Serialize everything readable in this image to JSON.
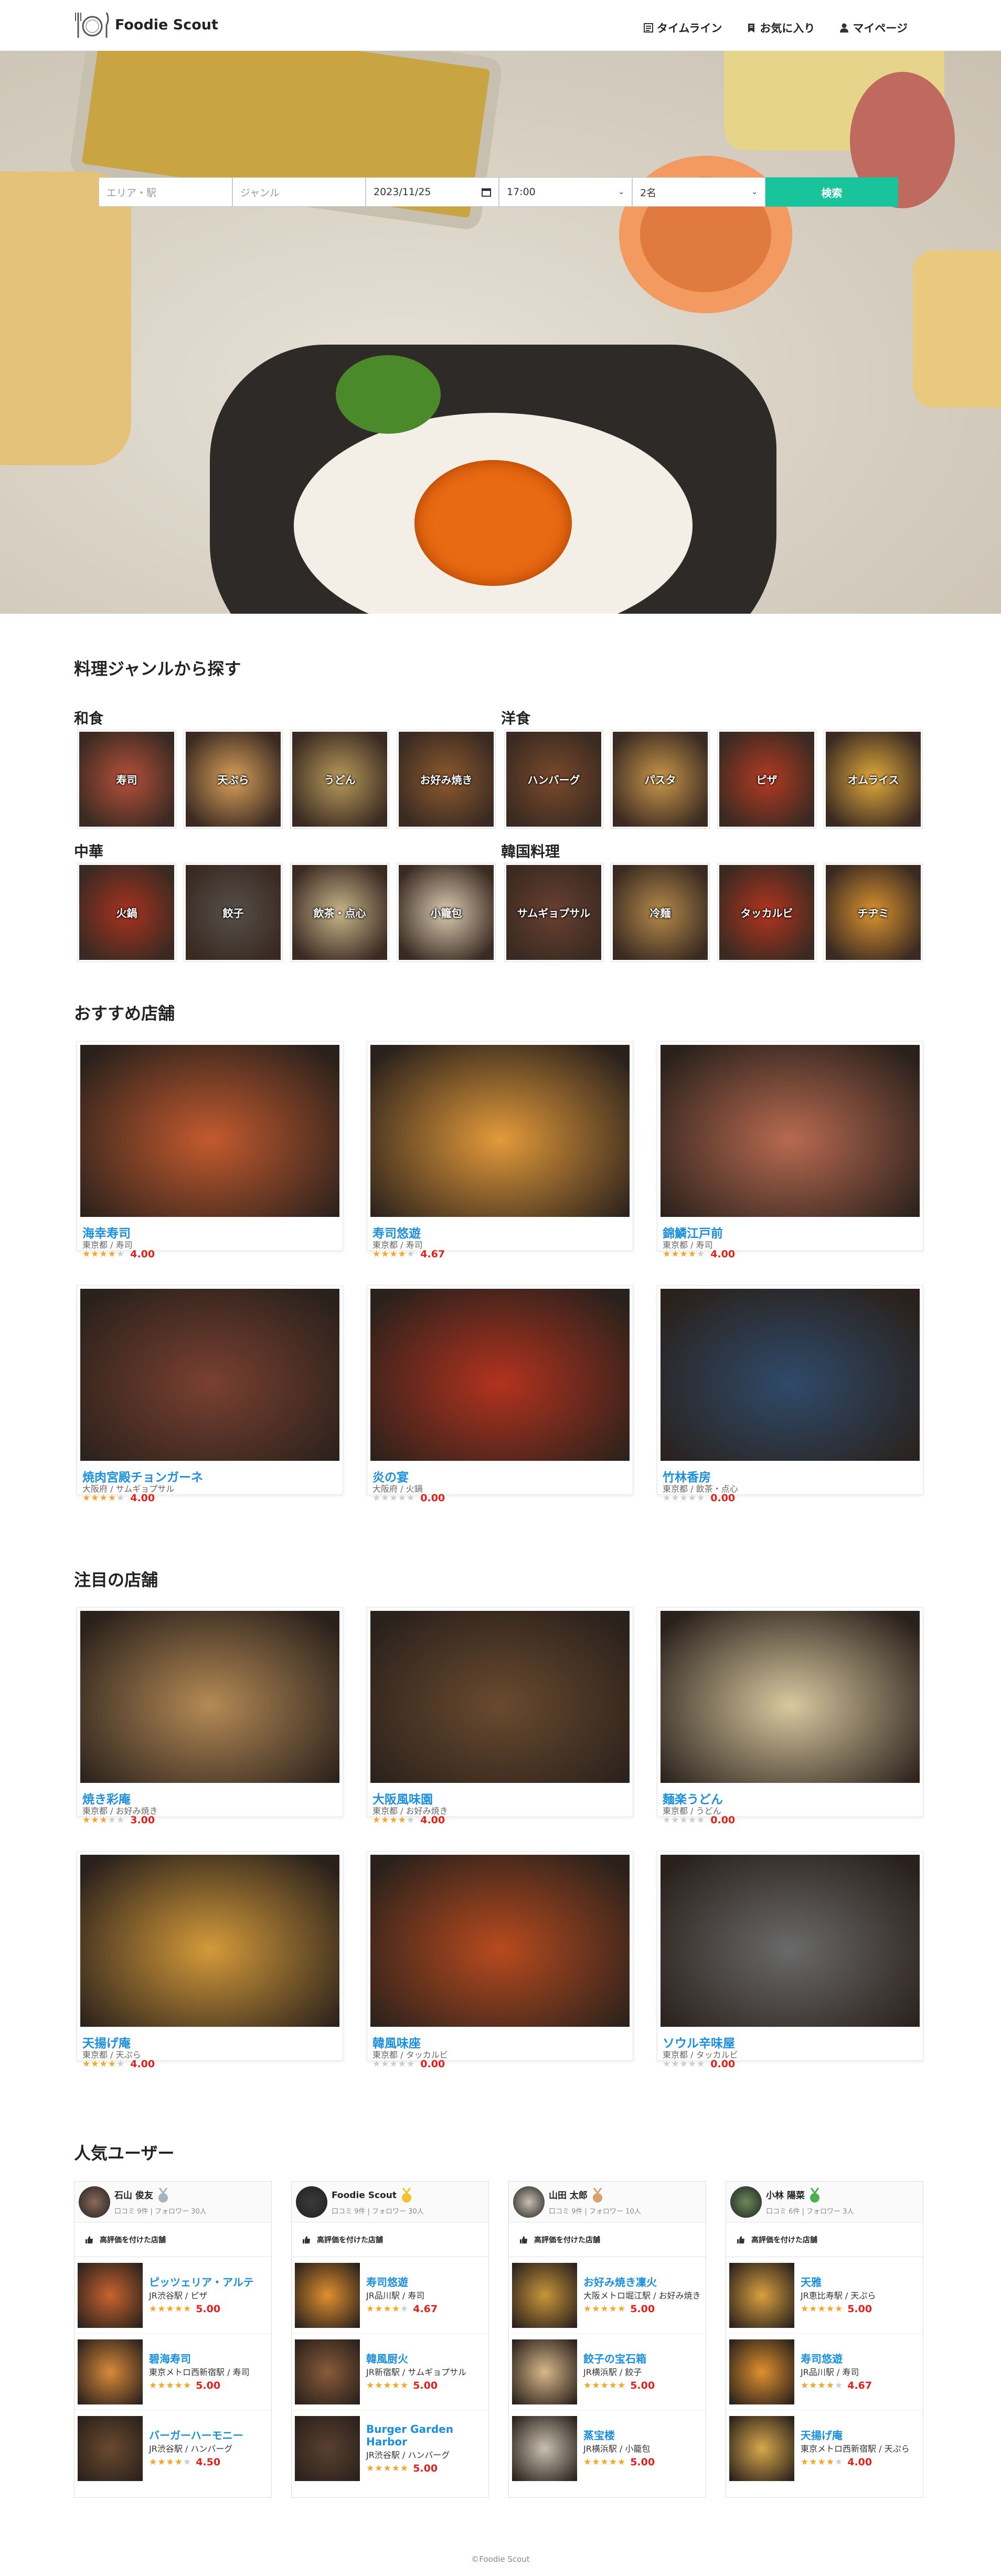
{
  "header": {
    "brand": "Foodie Scout",
    "nav": [
      {
        "label": "タイムライン",
        "icon": "timeline-icon"
      },
      {
        "label": "お気に入り",
        "icon": "bookmark-icon"
      },
      {
        "label": "マイページ",
        "icon": "user-icon"
      }
    ]
  },
  "search": {
    "area_placeholder": "エリア・駅",
    "genre_placeholder": "ジャンル",
    "date": "2023/11/25",
    "time": "17:00",
    "people": "2名",
    "button": "検索"
  },
  "genres": {
    "title": "料理ジャンルから探す",
    "categories": [
      {
        "name": "和食",
        "items": [
          "寿司",
          "天ぷら",
          "うどん",
          "お好み焼き"
        ]
      },
      {
        "name": "洋食",
        "items": [
          "ハンバーグ",
          "パスタ",
          "ピザ",
          "オムライス"
        ]
      },
      {
        "name": "中華",
        "items": [
          "火鍋",
          "餃子",
          "飲茶・点心",
          "小籠包"
        ]
      },
      {
        "name": "韓国料理",
        "items": [
          "サムギョプサル",
          "冷麺",
          "タッカルビ",
          "チヂミ"
        ]
      }
    ]
  },
  "recommended": {
    "title": "おすすめ店舗",
    "shops": [
      {
        "name": "海幸寿司",
        "area": "東京都 / 寿司",
        "rating": 4.0,
        "score": "4.00"
      },
      {
        "name": "寿司悠遊",
        "area": "東京都 / 寿司",
        "rating": 4.67,
        "score": "4.67"
      },
      {
        "name": "錦鱗江戸前",
        "area": "東京都 / 寿司",
        "rating": 4.0,
        "score": "4.00"
      },
      {
        "name": "焼肉宮殿チョンガーネ",
        "area": "大阪府 / サムギョプサル",
        "rating": 4.0,
        "score": "4.00"
      },
      {
        "name": "炎の宴",
        "area": "大阪府 / 火鍋",
        "rating": 0,
        "score": "0.00"
      },
      {
        "name": "竹林香房",
        "area": "東京都 / 飲茶・点心",
        "rating": 0,
        "score": "0.00"
      }
    ]
  },
  "featured": {
    "title": "注目の店舗",
    "shops": [
      {
        "name": "焼き彩庵",
        "area": "東京都 / お好み焼き",
        "rating": 3.0,
        "score": "3.00"
      },
      {
        "name": "大阪風味園",
        "area": "東京都 / お好み焼き",
        "rating": 4.0,
        "score": "4.00"
      },
      {
        "name": "麺楽うどん",
        "area": "東京都 / うどん",
        "rating": 0,
        "score": "0.00"
      },
      {
        "name": "天揚げ庵",
        "area": "東京都 / 天ぷら",
        "rating": 4.0,
        "score": "4.00"
      },
      {
        "name": "韓風味座",
        "area": "東京都 / タッカルビ",
        "rating": 0,
        "score": "0.00"
      },
      {
        "name": "ソウル辛味屋",
        "area": "東京都 / タッカルビ",
        "rating": 0,
        "score": "0.00"
      }
    ]
  },
  "users": {
    "title": "人気ユーザー",
    "label": "高評価を付けた店舗",
    "list": [
      {
        "name": "石山 俊友",
        "meta": "口コミ 9件 | フォロワー 30人",
        "medal": "#a7b3c0",
        "shops": [
          {
            "name": "ピッツェリア・アルテ",
            "sub": "JR渋谷駅 / ピザ",
            "rating": 5,
            "score": "5.00"
          },
          {
            "name": "碧海寿司",
            "sub": "東京メトロ西新宿駅 / 寿司",
            "rating": 5,
            "score": "5.00"
          },
          {
            "name": "バーガーハーモニー",
            "sub": "JR渋谷駅 / ハンバーグ",
            "rating": 4.5,
            "score": "4.50"
          }
        ]
      },
      {
        "name": "Foodie Scout",
        "meta": "口コミ 9件 | フォロワー 30人",
        "medal": "#f2c230",
        "shops": [
          {
            "name": "寿司悠遊",
            "sub": "JR品川駅 / 寿司",
            "rating": 4.67,
            "score": "4.67"
          },
          {
            "name": "韓風厨火",
            "sub": "JR新宿駅 / サムギョプサル",
            "rating": 5,
            "score": "5.00"
          },
          {
            "name": "Burger Garden Harbor",
            "sub": "JR渋谷駅 / ハンバーグ",
            "rating": 5,
            "score": "5.00"
          }
        ]
      },
      {
        "name": "山田 太郎",
        "meta": "口コミ 9件 | フォロワー 10人",
        "medal": "#d9a26b",
        "shops": [
          {
            "name": "お好み焼き凜火",
            "sub": "大阪メトロ堀江駅 / お好み焼き",
            "rating": 5,
            "score": "5.00"
          },
          {
            "name": "餃子の宝石箱",
            "sub": "JR横浜駅 / 餃子",
            "rating": 5,
            "score": "5.00"
          },
          {
            "name": "蒸宝楼",
            "sub": "JR横浜駅 / 小籠包",
            "rating": 5,
            "score": "5.00"
          }
        ]
      },
      {
        "name": "小林 陽菜",
        "meta": "口コミ 6件 | フォロワー 3人",
        "medal": "#4caf50",
        "shops": [
          {
            "name": "天雅",
            "sub": "JR恵比寿駅 / 天ぷら",
            "rating": 5,
            "score": "5.00"
          },
          {
            "name": "寿司悠遊",
            "sub": "JR品川駅 / 寿司",
            "rating": 4.67,
            "score": "4.67"
          },
          {
            "name": "天揚げ庵",
            "sub": "東京メトロ西新宿駅 / 天ぷら",
            "rating": 4,
            "score": "4.00"
          }
        ]
      }
    ]
  },
  "footer": "©Foodie Scout",
  "colors": {
    "accent": "#19c39b",
    "link": "#1a8fe0",
    "score": "#e0201a",
    "star": "#f5a623"
  }
}
